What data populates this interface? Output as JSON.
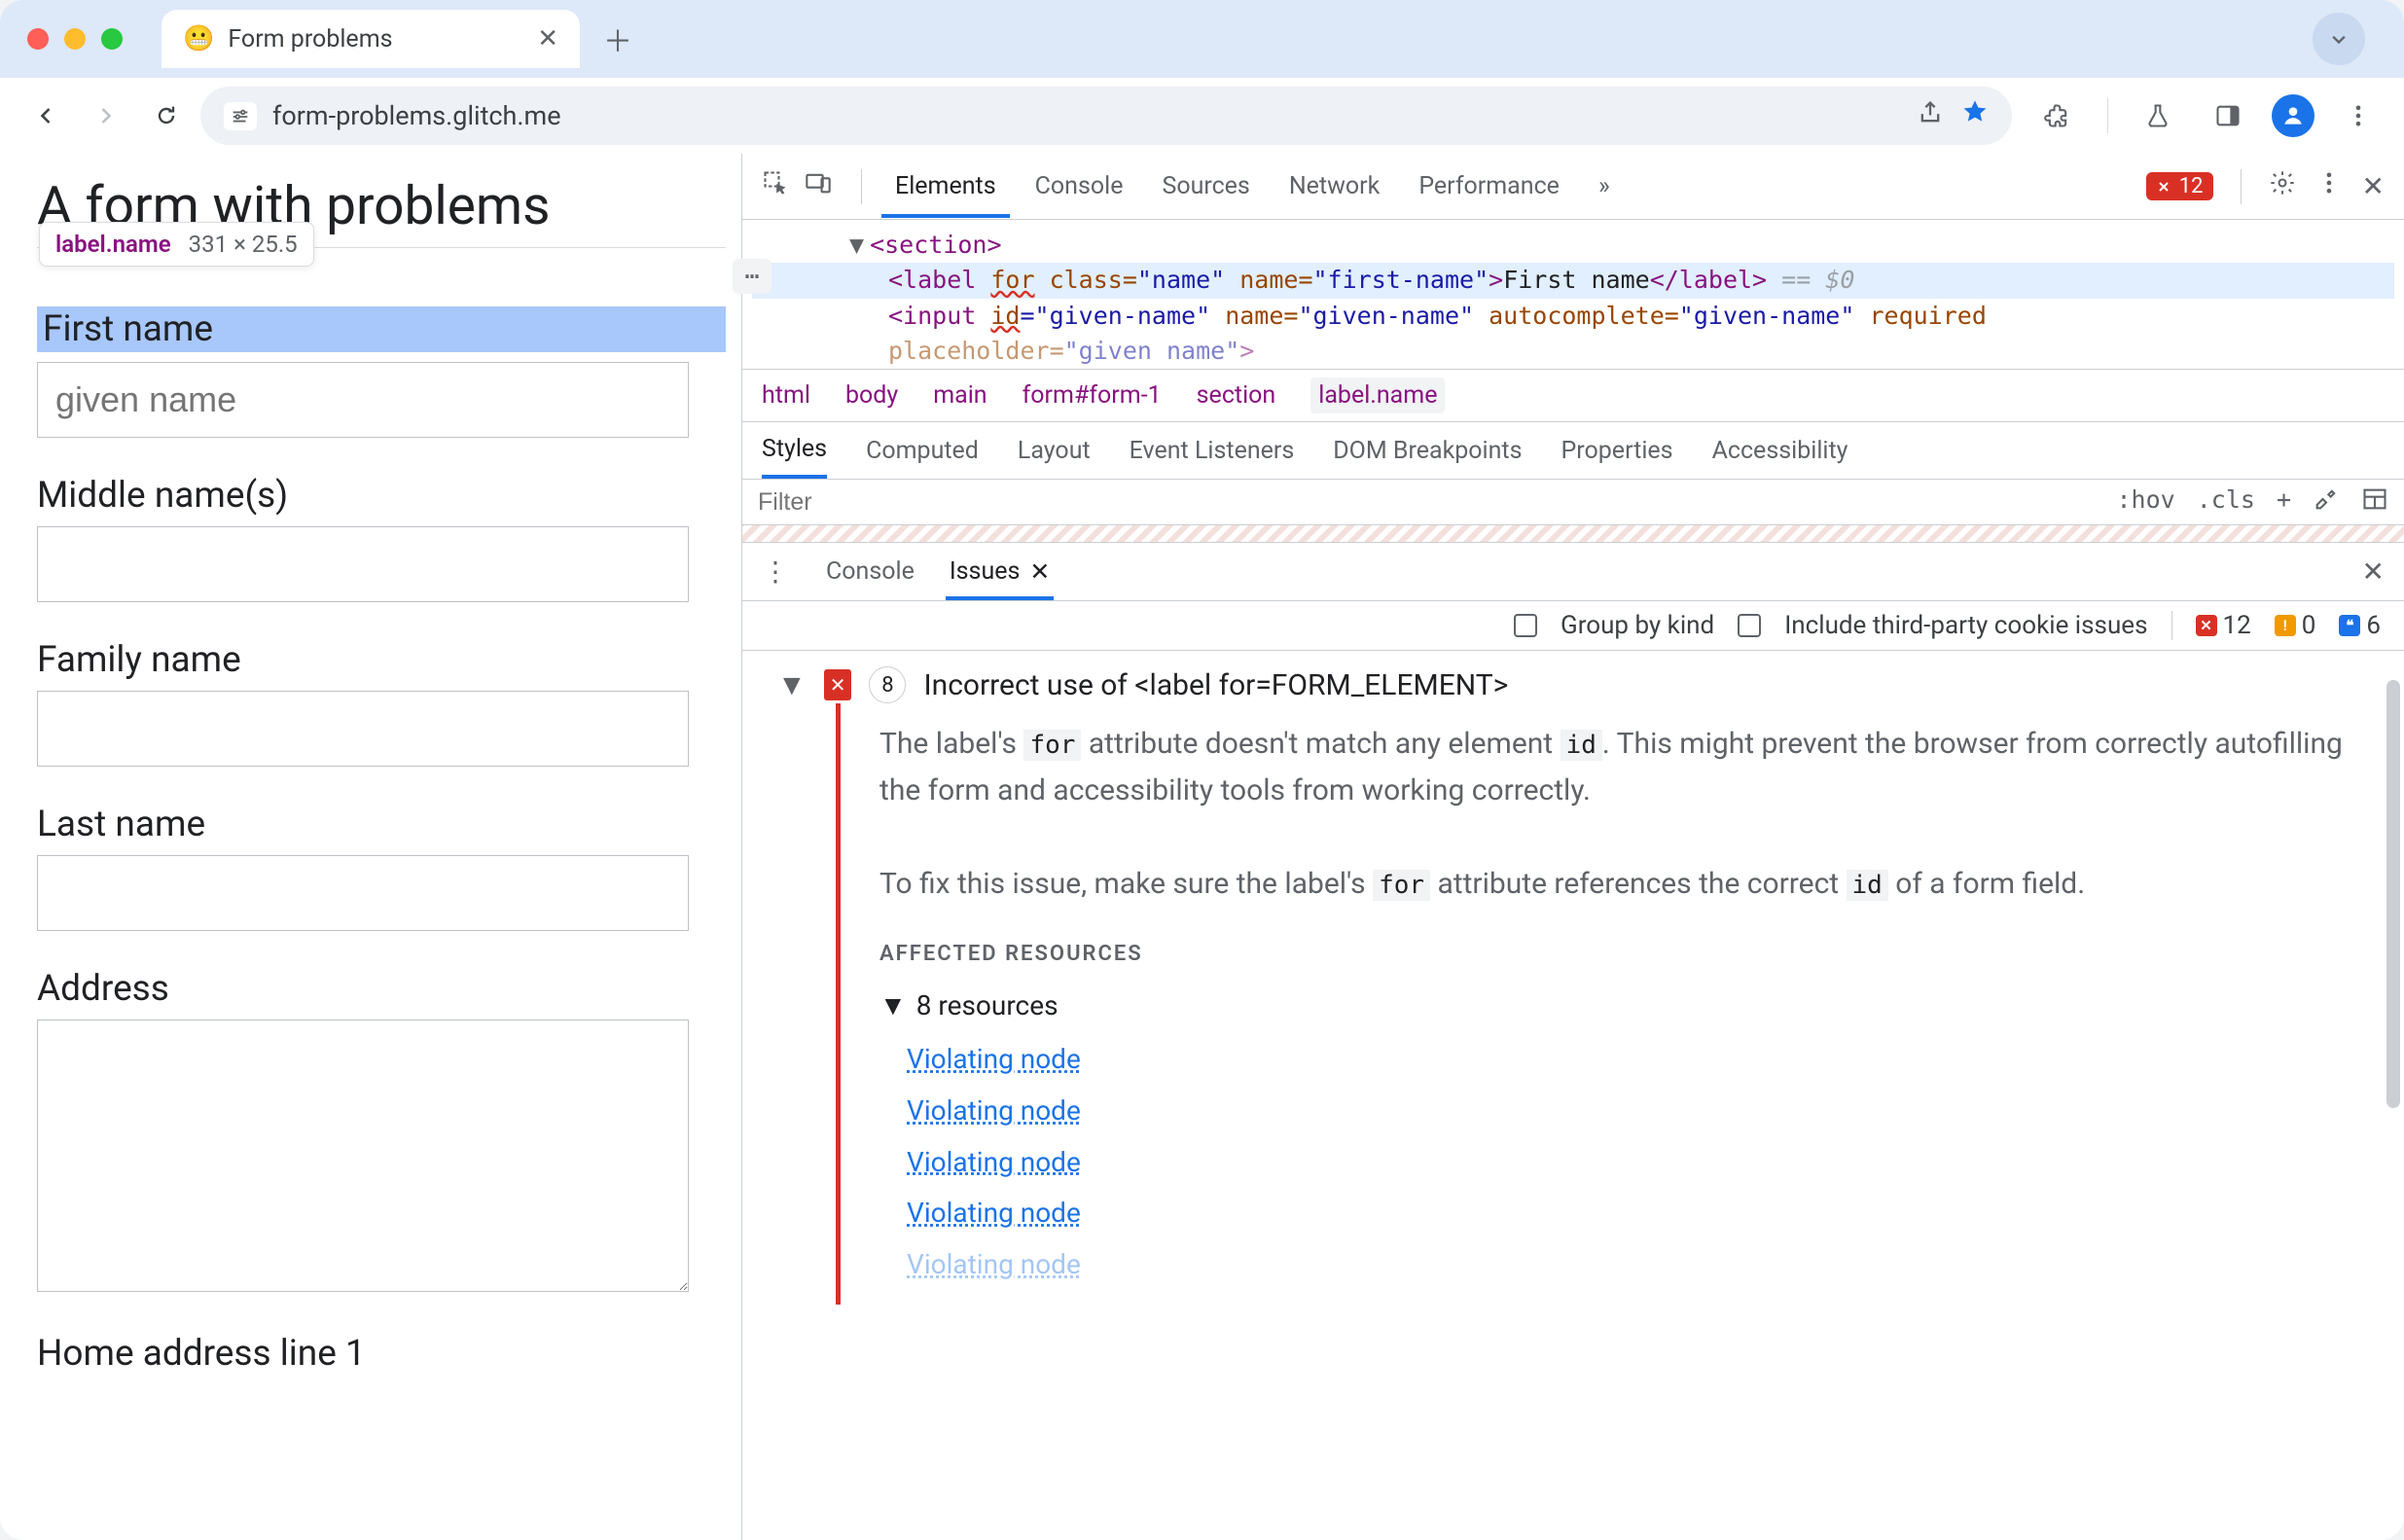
{
  "tab": {
    "title": "Form problems",
    "favicon": "😬"
  },
  "omnibox": {
    "url": "form-problems.glitch.me"
  },
  "page": {
    "heading": "A form with problems",
    "tooltip_selector": "label.name",
    "tooltip_dims": "331 × 25.5",
    "fields": {
      "first_name_label": "First name",
      "first_name_placeholder": "given name",
      "middle_label": "Middle name(s)",
      "family_label": "Family name",
      "last_label": "Last name",
      "address_label": "Address",
      "home1_label": "Home address line 1"
    }
  },
  "devtools": {
    "tabs": [
      "Elements",
      "Console",
      "Sources",
      "Network",
      "Performance"
    ],
    "more_tabs": "»",
    "error_count": "12",
    "dom": {
      "section_open": "<section>",
      "label_open_1": "<label ",
      "label_for": "for",
      "label_mid_1": " class=",
      "label_cls_val": "\"name\"",
      "label_mid_2": " name=",
      "label_name_val": "\"first-name\"",
      "label_close_1": ">",
      "label_text": "First name",
      "label_end": "</label>",
      "eq0": " == $0",
      "input_open": "<input ",
      "input_id": "id",
      "input_id_val": "=\"given-name\"",
      "input_name": " name=",
      "input_name_val": "\"given-name\"",
      "input_ac": " autocomplete=",
      "input_ac_val": "\"given-name\"",
      "input_req": " required",
      "input_ph": "placeholder=",
      "input_ph_val": "\"given name\"",
      "input_end": ">"
    },
    "crumbs": [
      "html",
      "body",
      "main",
      "form#form-1",
      "section",
      "label.name"
    ],
    "styles_tabs": [
      "Styles",
      "Computed",
      "Layout",
      "Event Listeners",
      "DOM Breakpoints",
      "Properties",
      "Accessibility"
    ],
    "filter_placeholder": "Filter",
    "filter_right": [
      ":hov",
      ".cls",
      "+"
    ]
  },
  "drawer": {
    "tabs": [
      "Console",
      "Issues"
    ],
    "options": {
      "group_label": "Group by kind",
      "thirdparty_label": "Include third-party cookie issues"
    },
    "counts": {
      "errors": "12",
      "warnings": "0",
      "info": "6"
    },
    "issue": {
      "count": "8",
      "title": "Incorrect use of <label for=FORM_ELEMENT>",
      "p1a": "The label's ",
      "p1code1": "for",
      "p1b": " attribute doesn't match any element ",
      "p1code2": "id",
      "p1c": ". This might prevent the browser from correctly autofilling the form and accessibility tools from working correctly.",
      "p2a": "To fix this issue, make sure the label's ",
      "p2code1": "for",
      "p2b": " attribute references the correct ",
      "p2code2": "id",
      "p2c": " of a form field.",
      "affected_heading": "AFFECTED RESOURCES",
      "resources_head": "8 resources",
      "violating_node": "Violating node"
    }
  }
}
